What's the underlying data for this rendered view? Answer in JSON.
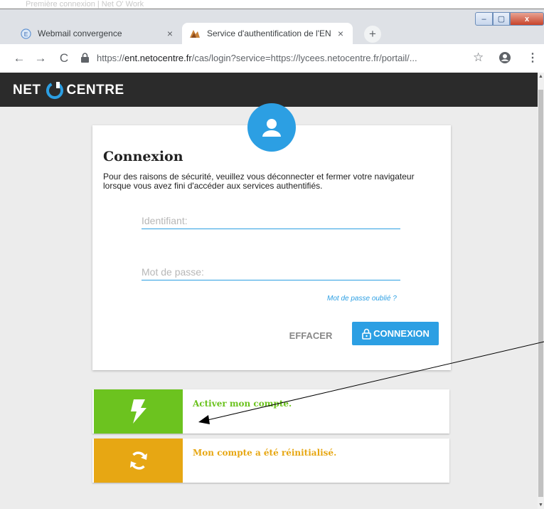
{
  "browser": {
    "top_ghost_text": "Première connexion | Net O' Work",
    "tabs": [
      {
        "title": "Webmail convergence",
        "close": "×"
      },
      {
        "title": "Service d'authentification de l'EN",
        "close": "×"
      }
    ],
    "new_tab": "+",
    "window_controls": {
      "minimize": "–",
      "maximize": "▢",
      "close": "x"
    },
    "url_prefix": "https://",
    "url_domain": "ent.netocentre.fr",
    "url_rest": "/cas/login?service=https://lycees.netocentre.fr/portail/...",
    "back": "←",
    "forward": "→",
    "reload": "C",
    "bookmark": "☆",
    "menu": "⋮"
  },
  "site": {
    "logo_left": "NET",
    "logo_right": "CENTRE"
  },
  "login": {
    "title": "Connexion",
    "description": "Pour des raisons de sécurité, veuillez vous déconnecter et fermer votre navigateur lorsque vous avez fini d'accéder aux services authentifiés.",
    "username_placeholder": "Identifiant:",
    "password_placeholder": "Mot de passe:",
    "forgot_link": "Mot de passe oublié ?",
    "clear_button": "EFFACER",
    "submit_button": "CONNEXION"
  },
  "actions": [
    {
      "label": "Activer mon compte.",
      "icon": "lightning-bolt-icon",
      "color": "#6cc31f"
    },
    {
      "label": "Mon compte a été réinitialisé.",
      "icon": "refresh-arrows-icon",
      "color": "#e7a713"
    }
  ],
  "colors": {
    "accent": "#2c9fe3",
    "header": "#2b2b2b",
    "background": "#ececec",
    "activate": "#6cc31f",
    "reset": "#e7a713"
  }
}
